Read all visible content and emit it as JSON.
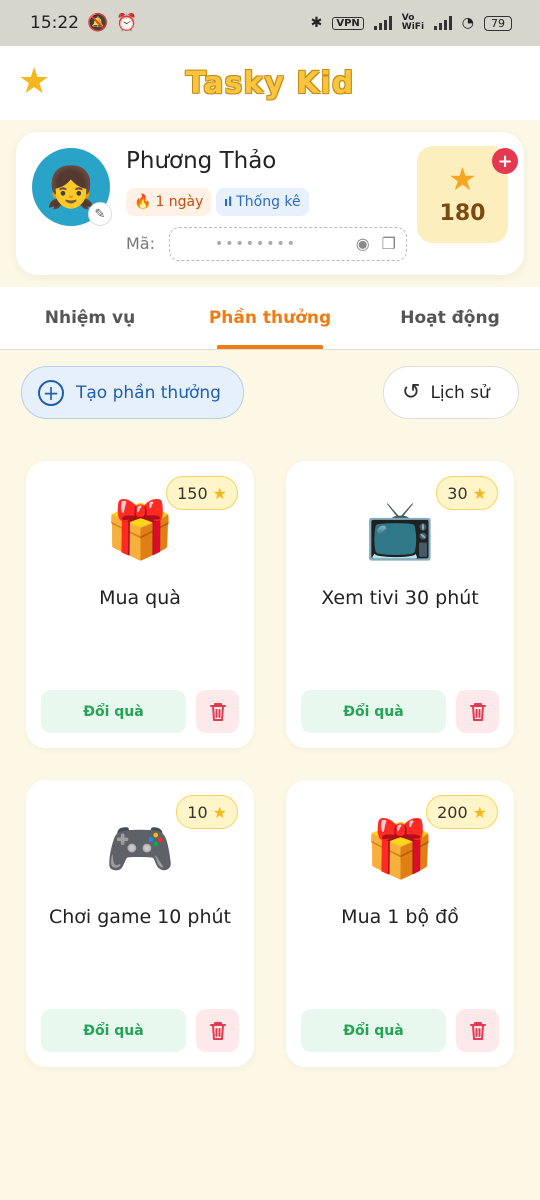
{
  "status_bar": {
    "time": "15:22",
    "vpn": "VPN",
    "vowifi": "Vo WiFi",
    "battery": "79"
  },
  "app": {
    "name": "Tasky Kid"
  },
  "profile": {
    "name": "Phương Thảo",
    "streak": "1 ngày",
    "stats_label": "Thống kê",
    "code_label": "Mã:",
    "code_masked": "••••••••",
    "stars": "180"
  },
  "tabs": [
    {
      "label": "Nhiệm vụ",
      "active": false
    },
    {
      "label": "Phần thưởng",
      "active": true
    },
    {
      "label": "Hoạt động",
      "active": false
    }
  ],
  "actions": {
    "create_label": "Tạo phần thưởng",
    "history_label": "Lịch sử"
  },
  "rewards": [
    {
      "title": "Mua quà",
      "cost": "150",
      "icon": "gift-icon",
      "redeem_label": "Đổi quà"
    },
    {
      "title": "Xem tivi 30 phút",
      "cost": "30",
      "icon": "tv-icon",
      "redeem_label": "Đổi quà"
    },
    {
      "title": "Chơi game 10 phút",
      "cost": "10",
      "icon": "game-controller-icon",
      "redeem_label": "Đổi quà"
    },
    {
      "title": "Mua 1 bộ đồ",
      "cost": "200",
      "icon": "gift-icon",
      "redeem_label": "Đổi quà"
    }
  ],
  "colors": {
    "accent": "#f07b12",
    "background": "#fdf8e6",
    "redeem_green": "#25a356",
    "delete_red": "#e53950",
    "star_gold": "#f5b81c"
  }
}
